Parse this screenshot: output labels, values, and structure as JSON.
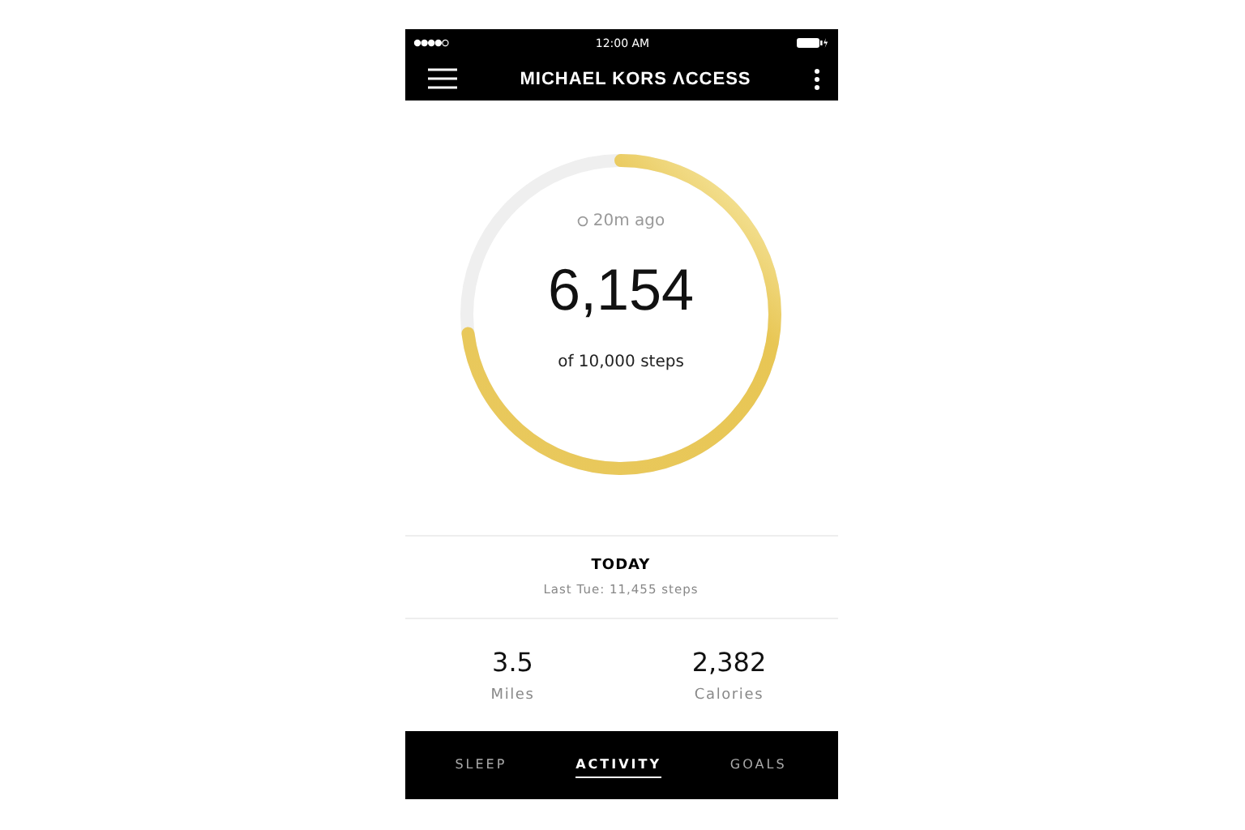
{
  "status_bar": {
    "time": "12:00 AM"
  },
  "header": {
    "title": "MICHAEL KORS ΛCCESS"
  },
  "progress": {
    "synced": "20m ago",
    "steps": "6,154",
    "goal": "of 10,000 steps"
  },
  "today": {
    "title": "TODAY",
    "comparison": "Last Tue: 11,455 steps"
  },
  "stats": [
    {
      "value": "3.5",
      "label": "Miles"
    },
    {
      "value": "2,382",
      "label": "Calories"
    }
  ],
  "tabs": [
    {
      "label": "SLEEP",
      "selected": false
    },
    {
      "label": "ACTIVITY",
      "selected": true
    },
    {
      "label": "GOALS",
      "selected": false
    }
  ]
}
